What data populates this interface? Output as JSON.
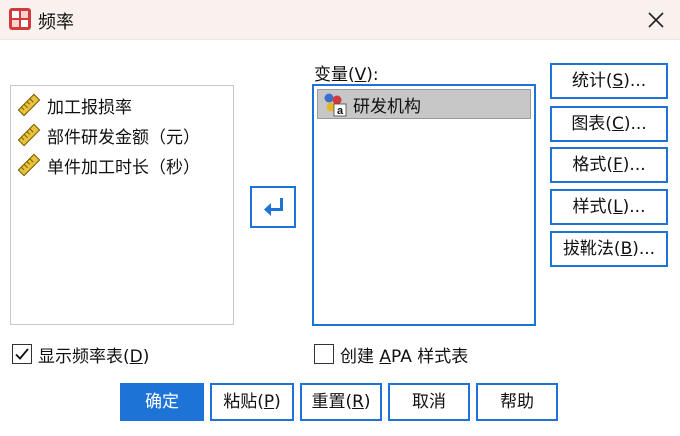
{
  "window": {
    "title": "频率"
  },
  "source_list": {
    "items": [
      {
        "label": "加工报损率"
      },
      {
        "label": "部件研发金额（元）"
      },
      {
        "label": "单件加工时长（秒）"
      }
    ]
  },
  "target": {
    "label_text": "变量(",
    "label_key": "V",
    "label_end": "):",
    "items": [
      {
        "label": "研发机构"
      }
    ]
  },
  "side_buttons": {
    "statistics": {
      "pre": "统计(",
      "key": "S",
      "post": ")..."
    },
    "charts": {
      "pre": "图表(",
      "key": "C",
      "post": ")..."
    },
    "format": {
      "pre": "格式(",
      "key": "F",
      "post": ")..."
    },
    "style": {
      "pre": "样式(",
      "key": "L",
      "post": ")..."
    },
    "bootstrap": {
      "pre": "拔靴法(",
      "key": "B",
      "post": ")..."
    }
  },
  "checkboxes": {
    "show_freq": {
      "pre": "显示频率表(",
      "key": "D",
      "post": ")",
      "checked": true
    },
    "apa": {
      "pre": "创建 ",
      "key": "A",
      "post": "PA 样式表",
      "checked": false
    }
  },
  "bottom_buttons": {
    "ok": {
      "label": "确定"
    },
    "paste": {
      "pre": "粘贴(",
      "key": "P",
      "post": ")"
    },
    "reset": {
      "pre": "重置(",
      "key": "R",
      "post": ")"
    },
    "cancel": {
      "label": "取消"
    },
    "help": {
      "label": "帮助"
    }
  },
  "colors": {
    "accent": "#1e74d6",
    "titlebar": "#f9f1ee",
    "selection": "#c7c7c7"
  }
}
